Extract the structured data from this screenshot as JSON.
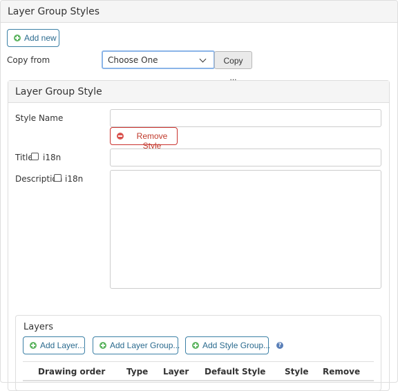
{
  "outer": {
    "title": "Layer Group Styles"
  },
  "add_new": {
    "label": "Add new"
  },
  "copy_from": {
    "label": "Copy from",
    "selected": "Choose One",
    "copy_button": "Copy ..."
  },
  "panel": {
    "title": "Layer Group Style",
    "style_name_label": "Style Name",
    "style_name_value": "",
    "remove_label": "Remove Style",
    "title_label": "Title",
    "title_i18n": "i18n",
    "title_value": "",
    "description_label": "Description",
    "description_i18n": "i18n",
    "description_value": ""
  },
  "layers": {
    "title": "Layers",
    "add_layer": "Add Layer...",
    "add_layer_group": "Add Layer Group...",
    "add_style_group": "Add Style Group...",
    "help": "?",
    "columns": [
      "Drawing order",
      "Type",
      "Layer",
      "Default Style",
      "Style",
      "Remove"
    ]
  },
  "icons": {
    "add": "plus-circle-icon",
    "remove": "minus-circle-icon",
    "help": "question-circle-icon",
    "dropdown": "chevron-down-icon"
  },
  "colors": {
    "add_icon": "#5fb562",
    "remove_icon": "#d9534f",
    "primary_border": "#3a7fa5",
    "danger_border": "#c9302c",
    "focus_border": "#8ab4e8"
  }
}
